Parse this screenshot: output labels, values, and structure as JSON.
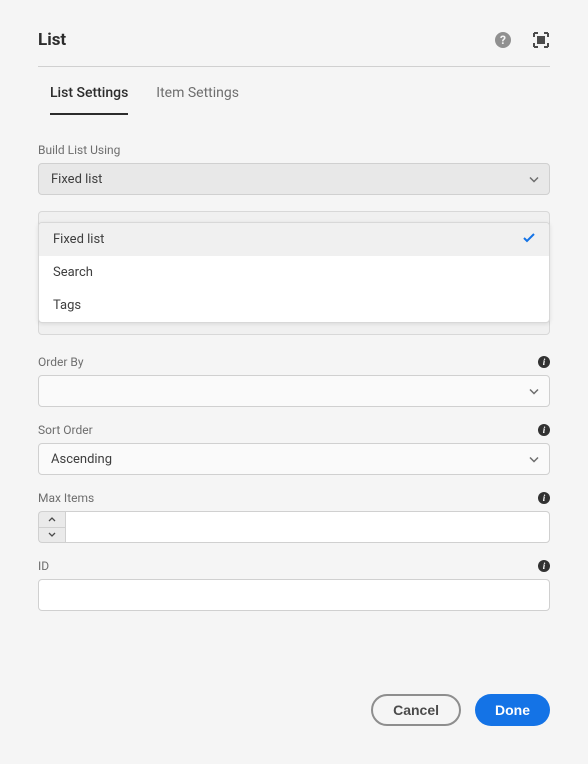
{
  "header": {
    "title": "List"
  },
  "tabs": {
    "list_settings": "List Settings",
    "item_settings": "Item Settings"
  },
  "fields": {
    "build_list_using": {
      "label": "Build List Using",
      "value": "Fixed list",
      "options": {
        "fixed_list": "Fixed list",
        "search": "Search",
        "tags": "Tags"
      }
    },
    "order_by": {
      "label": "Order By",
      "value": ""
    },
    "sort_order": {
      "label": "Sort Order",
      "value": "Ascending"
    },
    "max_items": {
      "label": "Max Items",
      "value": ""
    },
    "id": {
      "label": "ID",
      "value": ""
    }
  },
  "buttons": {
    "cancel": "Cancel",
    "done": "Done"
  }
}
